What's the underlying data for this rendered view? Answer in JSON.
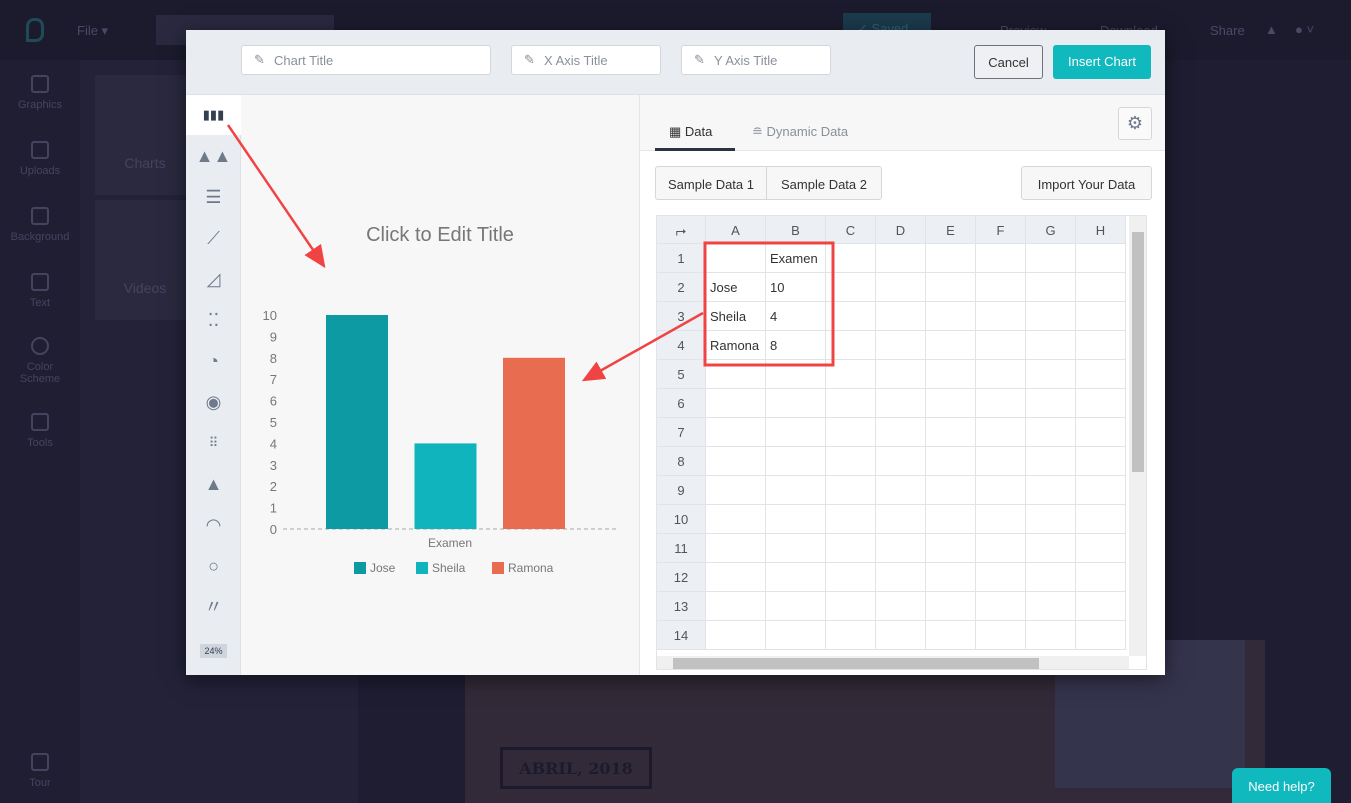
{
  "topbar": {
    "file": "File ▾",
    "save": "✓ Saved",
    "preview": "Preview",
    "download": "Download",
    "share": "Share"
  },
  "leftnav": [
    "Graphics",
    "Uploads",
    "Background",
    "Text",
    "Color Scheme",
    "Tools",
    "Tour"
  ],
  "panel": {
    "charts": "Charts",
    "videos": "Videos"
  },
  "canvas": {
    "date_text": "ABRIL, 2018"
  },
  "help": "Need help?",
  "modal": {
    "chart_title_placeholder": "Chart Title",
    "x_axis_placeholder": "X Axis Title",
    "y_axis_placeholder": "Y Axis Title",
    "cancel": "Cancel",
    "insert": "Insert Chart",
    "chart_types": [
      "bar-chart-icon",
      "column-peaks-icon",
      "horizontal-bar-icon",
      "line-chart-icon",
      "area-chart-icon",
      "scatter-icon",
      "pie-chart-icon",
      "donut-icon",
      "pictograph-icon",
      "pyramid-icon",
      "gauge-icon",
      "ring-icon",
      "sparkline-icon",
      "percent-icon"
    ],
    "percent_label": "24%",
    "tabs": [
      {
        "label": "Data",
        "active": true
      },
      {
        "label": "Dynamic Data",
        "active": false
      }
    ],
    "sample1": "Sample Data 1",
    "sample2": "Sample Data 2",
    "import": "Import Your Data",
    "columns": [
      "A",
      "B",
      "C",
      "D",
      "E",
      "F",
      "G",
      "H"
    ],
    "rows": [
      "1",
      "2",
      "3",
      "4",
      "5",
      "6",
      "7",
      "8",
      "9",
      "10",
      "11",
      "12",
      "13",
      "14"
    ],
    "cells": [
      [
        "",
        "Examen"
      ],
      [
        "Jose",
        "10"
      ],
      [
        "Sheila",
        "4"
      ],
      [
        "Ramona",
        "8"
      ]
    ]
  },
  "chart_data": {
    "type": "bar",
    "title": "Click to Edit Title",
    "categories": [
      "Examen"
    ],
    "series": [
      {
        "name": "Jose",
        "values": [
          10
        ],
        "color": "#0e9aa2"
      },
      {
        "name": "Sheila",
        "values": [
          4
        ],
        "color": "#10b4bc"
      },
      {
        "name": "Ramona",
        "values": [
          8
        ],
        "color": "#e86c4f"
      }
    ],
    "ylim": [
      0,
      10
    ],
    "yticks": [
      "0",
      "1",
      "2",
      "3",
      "4",
      "5",
      "6",
      "7",
      "8",
      "9",
      "10"
    ],
    "legend": "bottom",
    "grid": false
  },
  "colors": {
    "accent": "#10b9be",
    "annotation": "#f04444"
  }
}
